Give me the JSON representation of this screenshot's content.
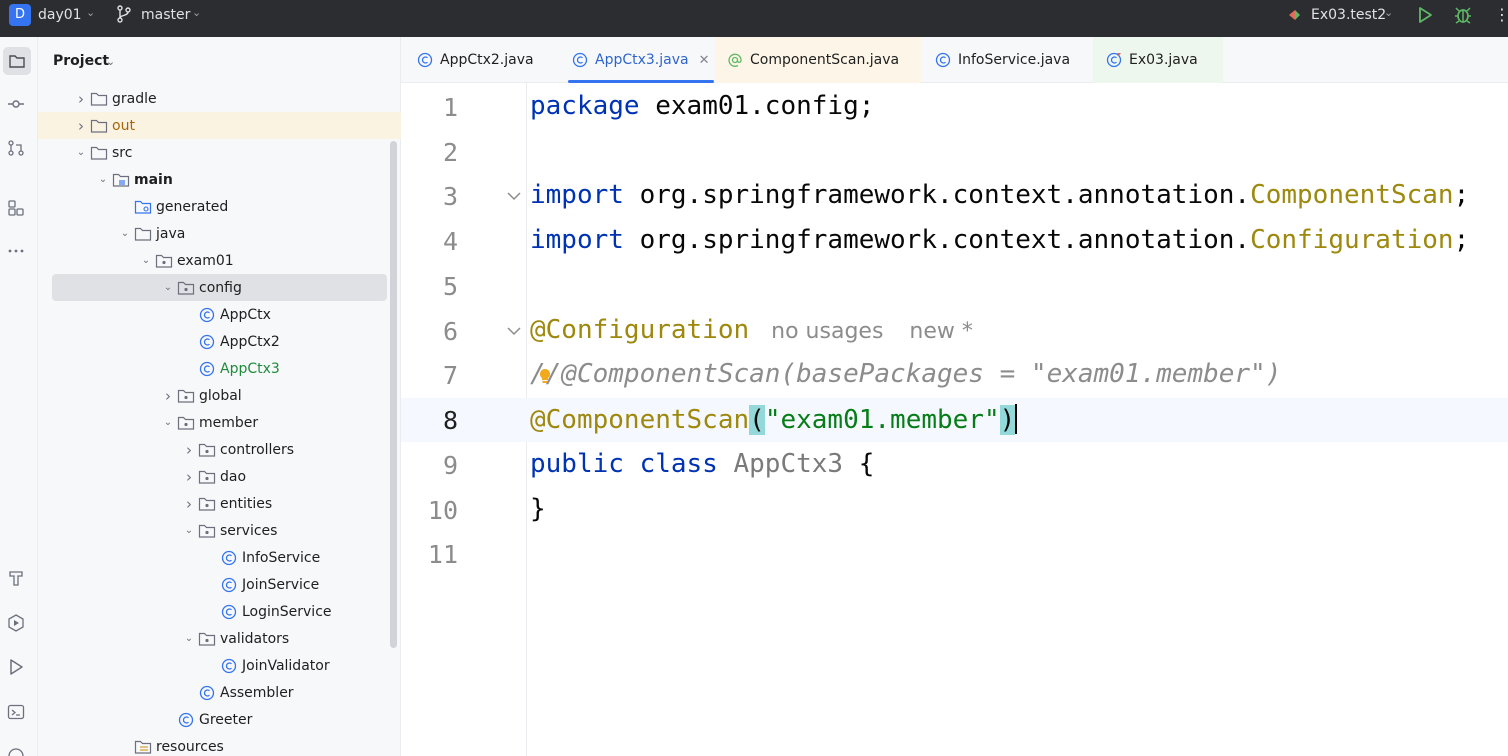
{
  "topbar": {
    "project_badge": "D",
    "project_name": "day01",
    "branch": "master",
    "run_config": "Ex03.test2"
  },
  "project_panel": {
    "title": "Project",
    "items": [
      {
        "label": "gradle",
        "type": "folder",
        "expanded": false
      },
      {
        "label": "out",
        "type": "folder",
        "expanded": false
      },
      {
        "label": "src",
        "type": "folder",
        "expanded": true
      },
      {
        "label": "main",
        "type": "source-root",
        "expanded": true
      },
      {
        "label": "generated",
        "type": "generated-folder"
      },
      {
        "label": "java",
        "type": "folder",
        "expanded": true
      },
      {
        "label": "exam01",
        "type": "package",
        "expanded": true
      },
      {
        "label": "config",
        "type": "package",
        "expanded": true
      },
      {
        "label": "AppCtx",
        "type": "class"
      },
      {
        "label": "AppCtx2",
        "type": "class"
      },
      {
        "label": "AppCtx3",
        "type": "class"
      },
      {
        "label": "global",
        "type": "package",
        "expanded": false
      },
      {
        "label": "member",
        "type": "package",
        "expanded": true
      },
      {
        "label": "controllers",
        "type": "package",
        "expanded": false
      },
      {
        "label": "dao",
        "type": "package",
        "expanded": false
      },
      {
        "label": "entities",
        "type": "package",
        "expanded": false
      },
      {
        "label": "services",
        "type": "package",
        "expanded": true
      },
      {
        "label": "InfoService",
        "type": "class"
      },
      {
        "label": "JoinService",
        "type": "class"
      },
      {
        "label": "LoginService",
        "type": "class"
      },
      {
        "label": "validators",
        "type": "package",
        "expanded": true
      },
      {
        "label": "JoinValidator",
        "type": "class"
      },
      {
        "label": "Assembler",
        "type": "class"
      },
      {
        "label": "Greeter",
        "type": "class"
      },
      {
        "label": "resources",
        "type": "resources-folder"
      }
    ]
  },
  "tabs": [
    {
      "label": "AppCtx2.java",
      "icon": "class-icon"
    },
    {
      "label": "AppCtx3.java",
      "icon": "class-icon",
      "active": true
    },
    {
      "label": "ComponentScan.java",
      "icon": "annotation-icon"
    },
    {
      "label": "InfoService.java",
      "icon": "class-icon"
    },
    {
      "label": "Ex03.java",
      "icon": "test-class-icon"
    }
  ],
  "editor": {
    "line_numbers": [
      "1",
      "2",
      "3",
      "4",
      "5",
      "6",
      "7",
      "8",
      "9",
      "10",
      "11"
    ],
    "line1": {
      "kw": "package",
      "rest": " exam01.config;"
    },
    "line3": {
      "kw": "import",
      "pkg": " org.springframework.context.annotation.",
      "cls": "ComponentScan",
      "end": ";"
    },
    "line4": {
      "kw": "import",
      "pkg": " org.springframework.context.annotation.",
      "cls": "Configuration",
      "end": ";"
    },
    "line6": {
      "ann": "@Configuration",
      "hint1": "no usages",
      "hint2": "new *"
    },
    "line7": {
      "comment_a": "/",
      "comment_b": "/@ComponentScan(basePackages = \"exam01.member\")"
    },
    "line8": {
      "ann": "@ComponentScan",
      "open": "(",
      "str": "\"exam01.member\"",
      "close": ")"
    },
    "line9": {
      "kw": "public class",
      "cls": " AppCtx3",
      "end": " {"
    },
    "line10": {
      "text": "}"
    }
  }
}
